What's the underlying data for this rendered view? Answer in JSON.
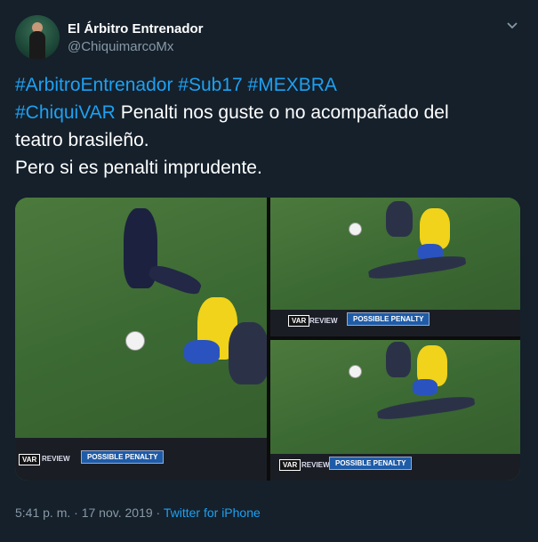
{
  "author": {
    "name": "El Árbitro Entrenador",
    "handle": "@ChiquimarcoMx"
  },
  "tweet": {
    "hashtags_line1": [
      "#ArbitroEntrenador",
      "#Sub17",
      "#MEXBRA"
    ],
    "hashtag_line2": "#ChiquiVAR",
    "text_line2": "Penalti nos guste o no acompañado del",
    "text_line3": "teatro brasileño.",
    "text_line4": "Pero si es penalti imprudente."
  },
  "media": {
    "var_label": "VAR",
    "review_label": "REVIEW",
    "penalty_label": "POSSIBLE PENALTY"
  },
  "footer": {
    "time": "5:41 p. m.",
    "date": "17 nov. 2019",
    "separator": "·",
    "source": "Twitter for iPhone"
  },
  "colors": {
    "background": "#15202b",
    "accent": "#1da1f2",
    "muted": "#8899a6"
  },
  "icons": {
    "menu": "chevron-down-icon"
  }
}
